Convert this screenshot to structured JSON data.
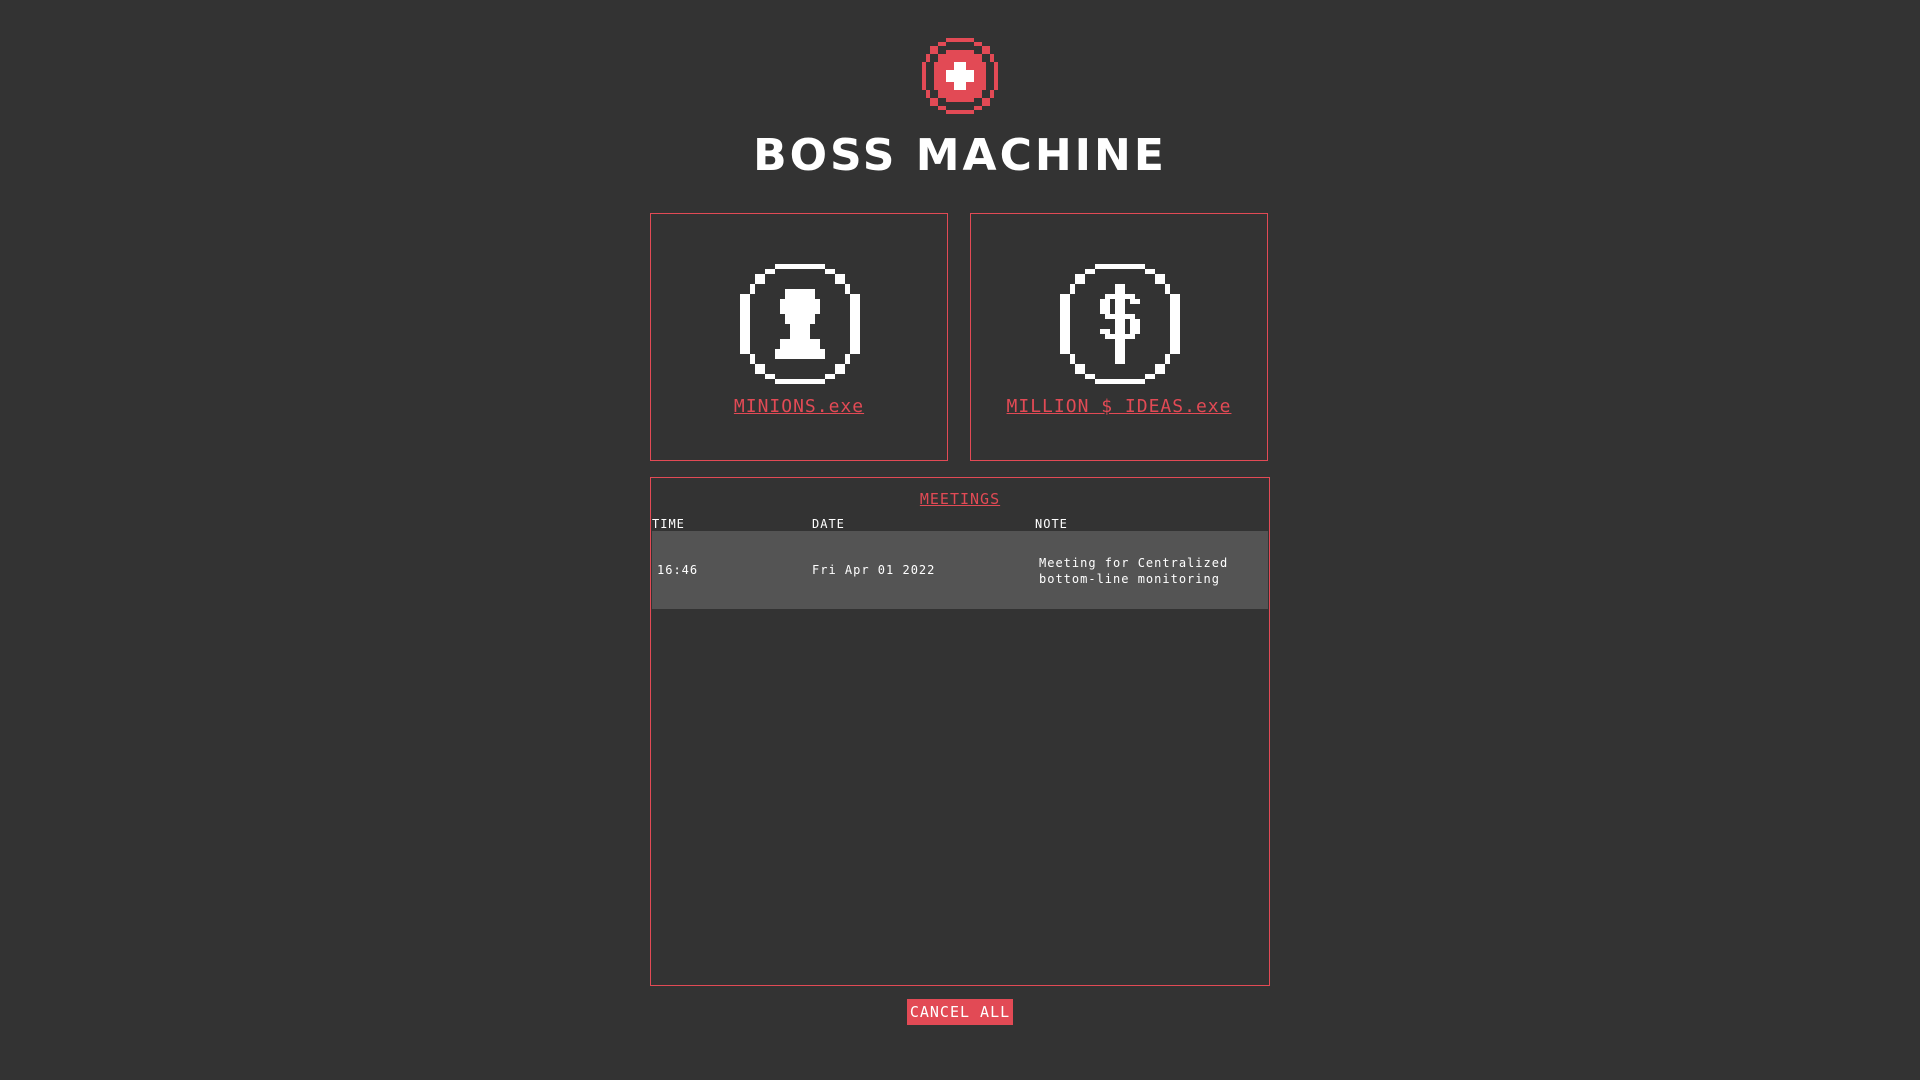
{
  "app": {
    "title": "BOSS MACHINE"
  },
  "colors": {
    "background": "#333333",
    "accent": "#e24a55",
    "row": "#545454",
    "text": "#ffffff"
  },
  "nav": {
    "minions": {
      "label": "MINIONS.exe",
      "icon": "minion-person-icon"
    },
    "ideas": {
      "label": "MILLION $ IDEAS.exe",
      "icon": "dollar-coin-icon"
    }
  },
  "meetings": {
    "title": "MEETINGS",
    "columns": {
      "time": "TIME",
      "date": "DATE",
      "note": "NOTE"
    },
    "rows": [
      {
        "time": "16:46",
        "date": "Fri Apr 01 2022",
        "note": "Meeting for Centralized bottom-line monitoring"
      }
    ]
  },
  "actions": {
    "cancel_all": "CANCEL ALL"
  }
}
